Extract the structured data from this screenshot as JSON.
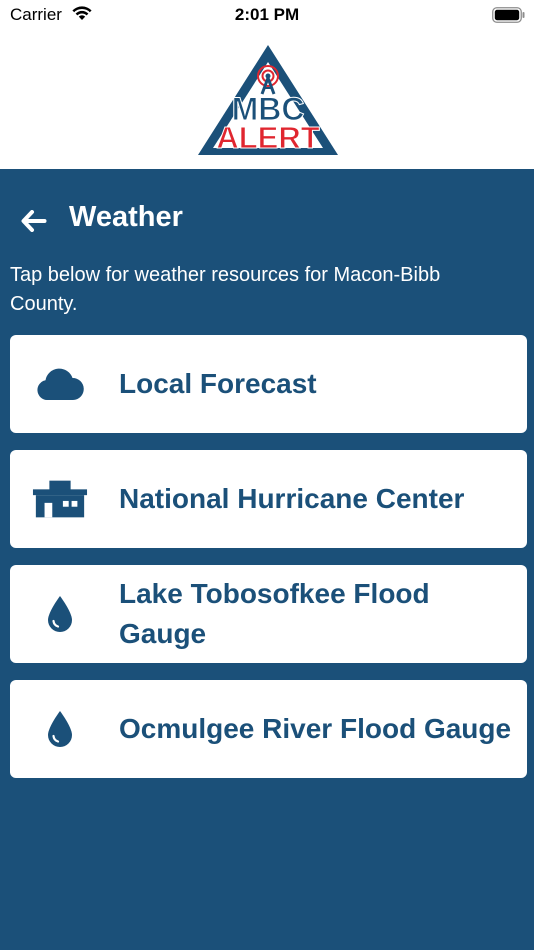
{
  "status_bar": {
    "carrier": "Carrier",
    "time": "2:01 PM"
  },
  "logo": {
    "line1": "MBC",
    "line2": "ALERT",
    "colors": {
      "blue": "#1b5079",
      "red": "#e0262f"
    }
  },
  "header": {
    "title": "Weather",
    "back_icon": "arrow-left-icon"
  },
  "intro": "Tap below for weather resources for Macon-Bibb County.",
  "items": [
    {
      "label": "Local Forecast",
      "icon": "cloud-icon"
    },
    {
      "label": "National Hurricane Center",
      "icon": "building-icon"
    },
    {
      "label": "Lake Tobosofkee Flood Gauge",
      "icon": "water-drop-icon"
    },
    {
      "label": "Ocmulgee River Flood Gauge",
      "icon": "water-drop-icon"
    }
  ],
  "colors": {
    "background": "#1b5079",
    "card": "#ffffff",
    "text_on_card": "#1b5079"
  }
}
